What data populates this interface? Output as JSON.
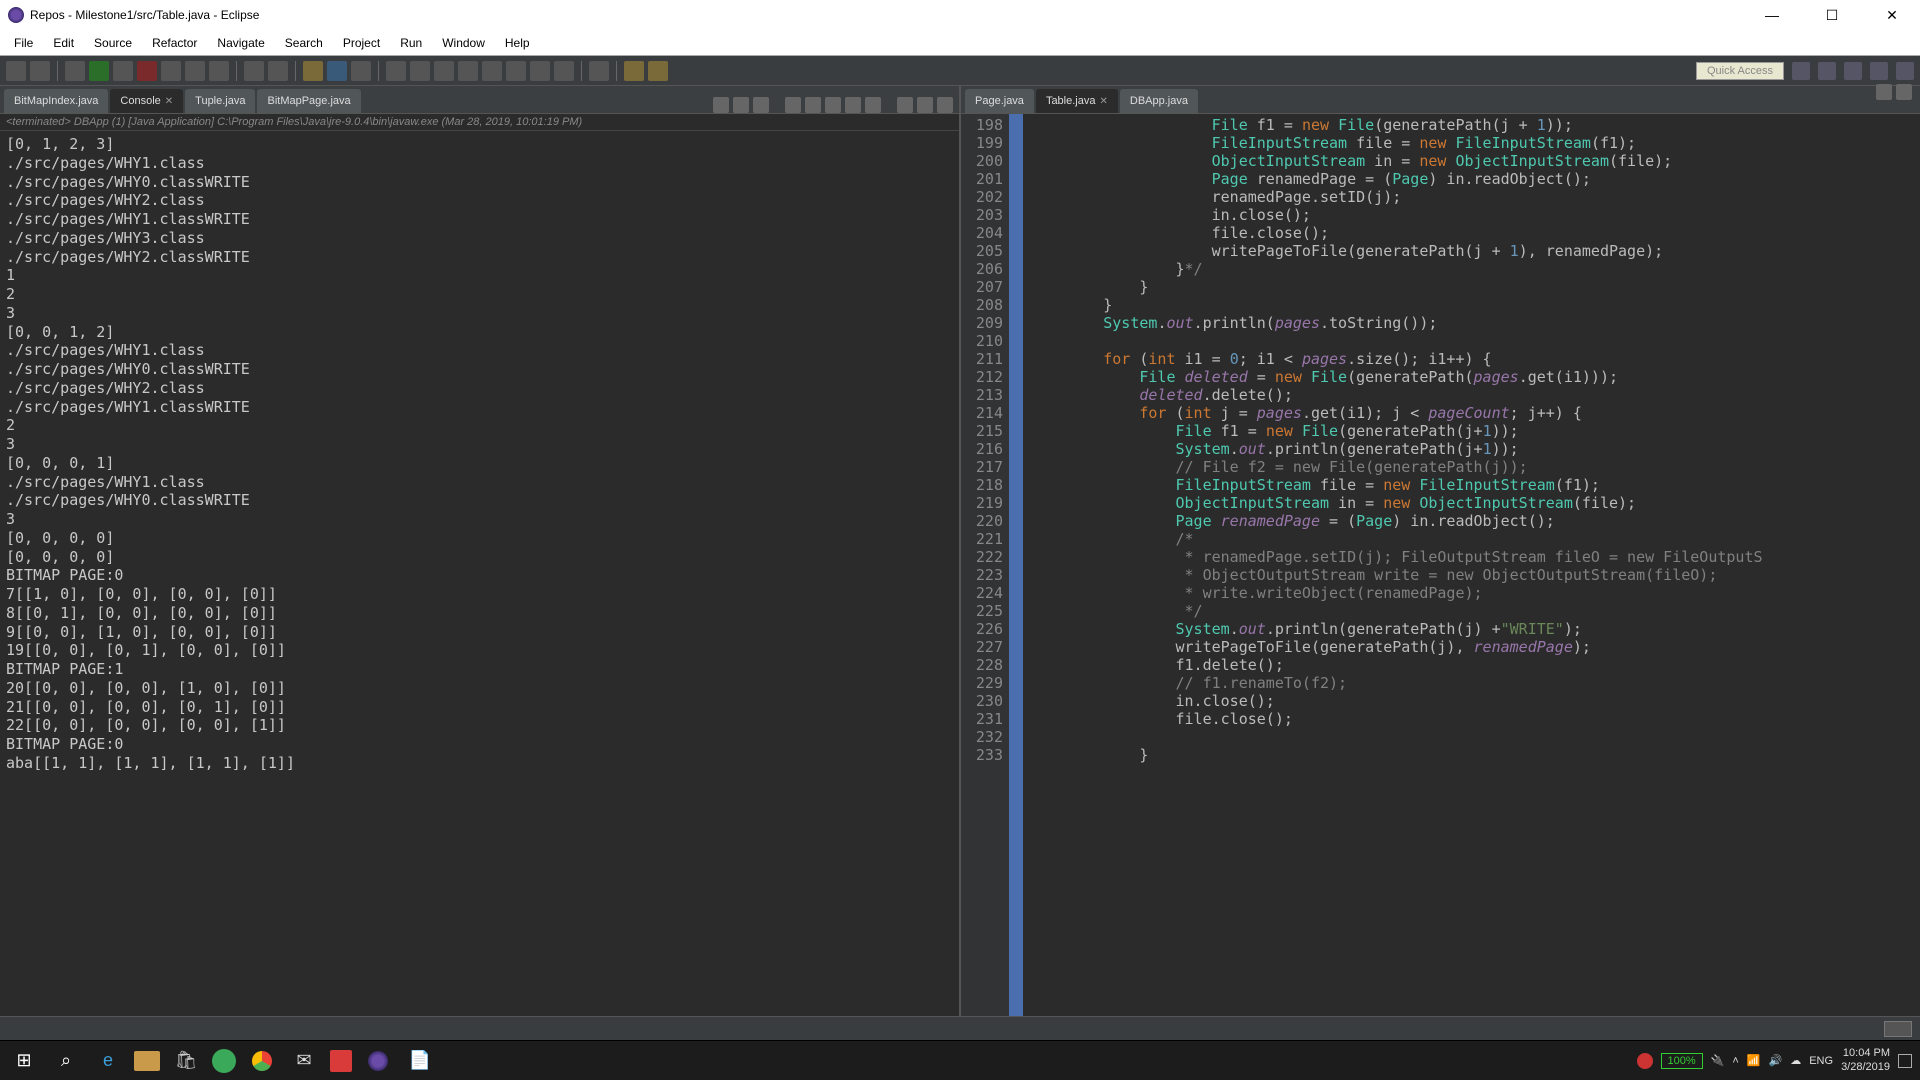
{
  "window": {
    "title": "Repos - Milestone1/src/Table.java - Eclipse"
  },
  "menu": [
    "File",
    "Edit",
    "Source",
    "Refactor",
    "Navigate",
    "Search",
    "Project",
    "Run",
    "Window",
    "Help"
  ],
  "quick_access": "Quick Access",
  "left": {
    "tabs": [
      {
        "label": "BitMapIndex.java",
        "active": false
      },
      {
        "label": "Console",
        "active": true,
        "closeable": true
      },
      {
        "label": "Tuple.java",
        "active": false
      },
      {
        "label": "BitMapPage.java",
        "active": false
      }
    ],
    "console_header": "<terminated> DBApp (1) [Java Application] C:\\Program Files\\Java\\jre-9.0.4\\bin\\javaw.exe (Mar 28, 2019, 10:01:19 PM)",
    "console_text": "[0, 1, 2, 3]\n./src/pages/WHY1.class\n./src/pages/WHY0.classWRITE\n./src/pages/WHY2.class\n./src/pages/WHY1.classWRITE\n./src/pages/WHY3.class\n./src/pages/WHY2.classWRITE\n1\n2\n3\n[0, 0, 1, 2]\n./src/pages/WHY1.class\n./src/pages/WHY0.classWRITE\n./src/pages/WHY2.class\n./src/pages/WHY1.classWRITE\n2\n3\n[0, 0, 0, 1]\n./src/pages/WHY1.class\n./src/pages/WHY0.classWRITE\n3\n[0, 0, 0, 0]\n[0, 0, 0, 0]\nBITMAP PAGE:0\n7[[1, 0], [0, 0], [0, 0], [0]]\n8[[0, 1], [0, 0], [0, 0], [0]]\n9[[0, 0], [1, 0], [0, 0], [0]]\n19[[0, 0], [0, 1], [0, 0], [0]]\nBITMAP PAGE:1\n20[[0, 0], [0, 0], [1, 0], [0]]\n21[[0, 0], [0, 0], [0, 1], [0]]\n22[[0, 0], [0, 0], [0, 0], [1]]\nBITMAP PAGE:0\naba[[1, 1], [1, 1], [1, 1], [1]]"
  },
  "right": {
    "tabs": [
      {
        "label": "Page.java",
        "active": false
      },
      {
        "label": "Table.java",
        "active": true,
        "closeable": true
      },
      {
        "label": "DBApp.java",
        "active": false
      }
    ],
    "first_line": 198,
    "lines": [
      {
        "n": 198,
        "t": [
          [
            "",
            "                    "
          ],
          [
            "cls",
            "File"
          ],
          [
            "",
            " f1 = "
          ],
          [
            "kw",
            "new"
          ],
          [
            "",
            " "
          ],
          [
            "cls",
            "File"
          ],
          [
            "",
            "(generatePath(j + "
          ],
          [
            "num",
            "1"
          ],
          [
            "",
            "));"
          ]
        ]
      },
      {
        "n": 199,
        "t": [
          [
            "",
            "                    "
          ],
          [
            "cls",
            "FileInputStream"
          ],
          [
            "",
            " file = "
          ],
          [
            "kw",
            "new"
          ],
          [
            "",
            " "
          ],
          [
            "cls",
            "FileInputStream"
          ],
          [
            "",
            "(f1);"
          ]
        ]
      },
      {
        "n": 200,
        "t": [
          [
            "",
            "                    "
          ],
          [
            "cls",
            "ObjectInputStream"
          ],
          [
            "",
            " in = "
          ],
          [
            "kw",
            "new"
          ],
          [
            "",
            " "
          ],
          [
            "cls",
            "ObjectInputStream"
          ],
          [
            "",
            "(file);"
          ]
        ]
      },
      {
        "n": 201,
        "t": [
          [
            "",
            "                    "
          ],
          [
            "cls",
            "Page"
          ],
          [
            "",
            " renamedPage = ("
          ],
          [
            "cls",
            "Page"
          ],
          [
            "",
            ") in.readObject();"
          ]
        ]
      },
      {
        "n": 202,
        "t": [
          [
            "",
            "                    renamedPage.setID(j);"
          ]
        ]
      },
      {
        "n": 203,
        "t": [
          [
            "",
            "                    in.close();"
          ]
        ]
      },
      {
        "n": 204,
        "t": [
          [
            "",
            "                    file.close();"
          ]
        ]
      },
      {
        "n": 205,
        "t": [
          [
            "",
            "                    writePageToFile(generatePath(j + "
          ],
          [
            "num",
            "1"
          ],
          [
            "",
            "), renamedPage);"
          ]
        ]
      },
      {
        "n": 206,
        "t": [
          [
            "",
            "                }"
          ],
          [
            "cmt",
            "*/"
          ]
        ]
      },
      {
        "n": 207,
        "t": [
          [
            "",
            "            }"
          ]
        ]
      },
      {
        "n": 208,
        "t": [
          [
            "",
            "        }"
          ]
        ]
      },
      {
        "n": 209,
        "t": [
          [
            "",
            "        "
          ],
          [
            "cls",
            "System"
          ],
          [
            "",
            "."
          ],
          [
            "fld",
            "out"
          ],
          [
            "",
            ".println("
          ],
          [
            "fld",
            "pages"
          ],
          [
            "",
            ".toString());"
          ]
        ]
      },
      {
        "n": 210,
        "t": [
          [
            "",
            ""
          ]
        ]
      },
      {
        "n": 211,
        "t": [
          [
            "",
            "        "
          ],
          [
            "kw",
            "for"
          ],
          [
            "",
            " ("
          ],
          [
            "kw",
            "int"
          ],
          [
            "",
            " i1 = "
          ],
          [
            "num",
            "0"
          ],
          [
            "",
            "; i1 < "
          ],
          [
            "fld",
            "pages"
          ],
          [
            "",
            ".size(); i1++) {"
          ]
        ]
      },
      {
        "n": 212,
        "t": [
          [
            "",
            "            "
          ],
          [
            "cls",
            "File"
          ],
          [
            "",
            " "
          ],
          [
            "fld",
            "deleted"
          ],
          [
            "",
            " = "
          ],
          [
            "kw",
            "new"
          ],
          [
            "",
            " "
          ],
          [
            "cls",
            "File"
          ],
          [
            "",
            "(generatePath("
          ],
          [
            "fld",
            "pages"
          ],
          [
            "",
            ".get(i1)));"
          ]
        ]
      },
      {
        "n": 213,
        "t": [
          [
            "",
            "            "
          ],
          [
            "fld",
            "deleted"
          ],
          [
            "",
            ".delete();"
          ]
        ]
      },
      {
        "n": 214,
        "t": [
          [
            "",
            "            "
          ],
          [
            "kw",
            "for"
          ],
          [
            "",
            " ("
          ],
          [
            "kw",
            "int"
          ],
          [
            "",
            " j = "
          ],
          [
            "fld",
            "pages"
          ],
          [
            "",
            ".get(i1); j < "
          ],
          [
            "fld",
            "pageCount"
          ],
          [
            "",
            "; j++) {"
          ]
        ]
      },
      {
        "n": 215,
        "t": [
          [
            "",
            "                "
          ],
          [
            "cls",
            "File"
          ],
          [
            "",
            " f1 = "
          ],
          [
            "kw",
            "new"
          ],
          [
            "",
            " "
          ],
          [
            "cls",
            "File"
          ],
          [
            "",
            "(generatePath(j+"
          ],
          [
            "num",
            "1"
          ],
          [
            "",
            "));"
          ]
        ]
      },
      {
        "n": 216,
        "t": [
          [
            "",
            "                "
          ],
          [
            "cls",
            "System"
          ],
          [
            "",
            "."
          ],
          [
            "fld",
            "out"
          ],
          [
            "",
            ".println(generatePath(j+"
          ],
          [
            "num",
            "1"
          ],
          [
            "",
            "));"
          ]
        ]
      },
      {
        "n": 217,
        "t": [
          [
            "",
            "                "
          ],
          [
            "cmt",
            "// File f2 = new File(generatePath(j));"
          ]
        ]
      },
      {
        "n": 218,
        "t": [
          [
            "",
            "                "
          ],
          [
            "cls",
            "FileInputStream"
          ],
          [
            "",
            " file = "
          ],
          [
            "kw",
            "new"
          ],
          [
            "",
            " "
          ],
          [
            "cls",
            "FileInputStream"
          ],
          [
            "",
            "(f1);"
          ]
        ]
      },
      {
        "n": 219,
        "t": [
          [
            "",
            "                "
          ],
          [
            "cls",
            "ObjectInputStream"
          ],
          [
            "",
            " in = "
          ],
          [
            "kw",
            "new"
          ],
          [
            "",
            " "
          ],
          [
            "cls",
            "ObjectInputStream"
          ],
          [
            "",
            "(file);"
          ]
        ]
      },
      {
        "n": 220,
        "t": [
          [
            "",
            "                "
          ],
          [
            "cls",
            "Page"
          ],
          [
            "",
            " "
          ],
          [
            "fld",
            "renamedPage"
          ],
          [
            "",
            " = ("
          ],
          [
            "cls",
            "Page"
          ],
          [
            "",
            ") in.readObject();"
          ]
        ]
      },
      {
        "n": 221,
        "t": [
          [
            "",
            "                "
          ],
          [
            "cmt",
            "/*"
          ]
        ]
      },
      {
        "n": 222,
        "t": [
          [
            "",
            "                 "
          ],
          [
            "cmt",
            "* renamedPage.setID(j); FileOutputStream fileO = new FileOutputS"
          ]
        ]
      },
      {
        "n": 223,
        "t": [
          [
            "",
            "                 "
          ],
          [
            "cmt",
            "* ObjectOutputStream write = new ObjectOutputStream(fileO);"
          ]
        ]
      },
      {
        "n": 224,
        "t": [
          [
            "",
            "                 "
          ],
          [
            "cmt",
            "* write.writeObject(renamedPage);"
          ]
        ]
      },
      {
        "n": 225,
        "t": [
          [
            "",
            "                 "
          ],
          [
            "cmt",
            "*/"
          ]
        ]
      },
      {
        "n": 226,
        "t": [
          [
            "",
            "                "
          ],
          [
            "cls",
            "System"
          ],
          [
            "",
            "."
          ],
          [
            "fld",
            "out"
          ],
          [
            "",
            ".println(generatePath(j) +"
          ],
          [
            "str",
            "\"WRITE\""
          ],
          [
            "",
            ");"
          ]
        ]
      },
      {
        "n": 227,
        "t": [
          [
            "",
            "                writePageToFile(generatePath(j), "
          ],
          [
            "fld",
            "renamedPage"
          ],
          [
            "",
            ");"
          ]
        ]
      },
      {
        "n": 228,
        "t": [
          [
            "",
            "                f1.delete();"
          ]
        ]
      },
      {
        "n": 229,
        "t": [
          [
            "",
            "                "
          ],
          [
            "cmt",
            "// f1.renameTo(f2);"
          ]
        ]
      },
      {
        "n": 230,
        "t": [
          [
            "",
            "                in.close();"
          ]
        ]
      },
      {
        "n": 231,
        "t": [
          [
            "",
            "                file.close();"
          ]
        ]
      },
      {
        "n": 232,
        "t": [
          [
            "",
            ""
          ]
        ]
      },
      {
        "n": 233,
        "t": [
          [
            "",
            "            }"
          ]
        ]
      }
    ]
  },
  "taskbar": {
    "battery": "100%",
    "lang": "ENG",
    "time": "10:04 PM",
    "date": "3/28/2019"
  }
}
